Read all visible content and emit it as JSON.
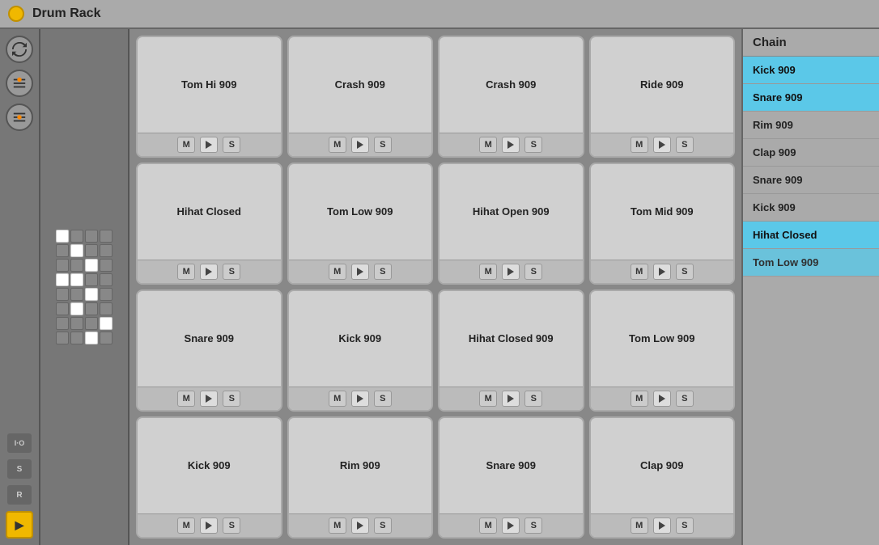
{
  "title": "Drum Rack",
  "pads": [
    {
      "name": "Tom Hi 909",
      "row": 0,
      "col": 0
    },
    {
      "name": "Crash 909",
      "row": 0,
      "col": 1
    },
    {
      "name": "Crash 909",
      "row": 0,
      "col": 2
    },
    {
      "name": "Ride 909",
      "row": 0,
      "col": 3
    },
    {
      "name": "Hihat Closed",
      "row": 1,
      "col": 0
    },
    {
      "name": "Tom Low 909",
      "row": 1,
      "col": 1
    },
    {
      "name": "Hihat Open 909",
      "row": 1,
      "col": 2
    },
    {
      "name": "Tom Mid 909",
      "row": 1,
      "col": 3
    },
    {
      "name": "Snare 909",
      "row": 2,
      "col": 0
    },
    {
      "name": "Kick 909",
      "row": 2,
      "col": 1
    },
    {
      "name": "Hihat Closed 909",
      "row": 2,
      "col": 2
    },
    {
      "name": "Tom Low 909",
      "row": 2,
      "col": 3
    },
    {
      "name": "Kick 909",
      "row": 3,
      "col": 0
    },
    {
      "name": "Rim 909",
      "row": 3,
      "col": 1
    },
    {
      "name": "Snare 909",
      "row": 3,
      "col": 2
    },
    {
      "name": "Clap 909",
      "row": 3,
      "col": 3
    }
  ],
  "controls": {
    "mute": "M",
    "play": "▶",
    "solo": "S"
  },
  "chain": {
    "title": "Chain",
    "items": [
      {
        "label": "Kick 909",
        "highlighted": true
      },
      {
        "label": "Snare 909",
        "highlighted": true
      },
      {
        "label": "Rim 909",
        "highlighted": false
      },
      {
        "label": "Clap 909",
        "highlighted": false
      },
      {
        "label": "Snare 909",
        "highlighted": false
      },
      {
        "label": "Kick 909",
        "highlighted": false
      },
      {
        "label": "Hihat Closed",
        "highlighted": true
      },
      {
        "label": "Tom Low 909",
        "highlighted": true,
        "partial": true
      }
    ]
  },
  "sidebar": {
    "buttons": [
      "↺",
      "≡",
      "≡",
      "I·O",
      "S",
      "R"
    ]
  }
}
